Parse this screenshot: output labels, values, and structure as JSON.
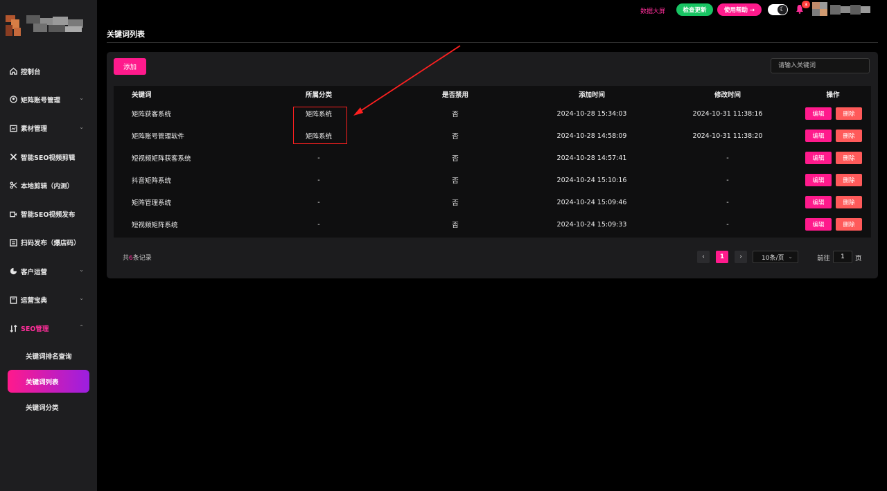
{
  "sidebar": {
    "items": [
      {
        "label": "控制台",
        "icon": "home-icon"
      },
      {
        "label": "矩阵账号管理",
        "icon": "account-icon",
        "chevron": "⌄"
      },
      {
        "label": "素材管理",
        "icon": "material-icon",
        "chevron": "⌄"
      },
      {
        "label": "智能SEO视频剪辑",
        "icon": "scissors-icon"
      },
      {
        "label": "本地剪辑（内测）",
        "icon": "cut-icon"
      },
      {
        "label": "智能SEO视频发布",
        "icon": "video-icon"
      },
      {
        "label": "扫码发布（爆店码）",
        "icon": "qrcode-icon"
      },
      {
        "label": "客户运营",
        "icon": "pie-icon",
        "chevron": "⌄"
      },
      {
        "label": "运营宝典",
        "icon": "book-icon",
        "chevron": "⌄"
      },
      {
        "label": "SEO管理",
        "icon": "seo-icon",
        "chevron": "⌃"
      }
    ],
    "sub_items": [
      {
        "label": "关键词排名查询"
      },
      {
        "label": "关键词列表"
      },
      {
        "label": "关键词分类"
      }
    ]
  },
  "topbar": {
    "dashboard_link": "数据大屏",
    "check_update": "检查更新",
    "help": "使用帮助 →",
    "notification_count": "3",
    "theme_toggle_icon": "moon-icon"
  },
  "main": {
    "title": "关键词列表",
    "add_button": "添加",
    "search_placeholder": "请输入关键词",
    "table": {
      "headers": [
        "关键词",
        "所属分类",
        "是否禁用",
        "添加时间",
        "修改时间",
        "操作"
      ],
      "rows": [
        {
          "keyword": "矩阵获客系统",
          "category": "矩阵系统",
          "disabled": "否",
          "added": "2024-10-28 15:34:03",
          "modified": "2024-10-31 11:38:16"
        },
        {
          "keyword": "矩阵账号管理软件",
          "category": "矩阵系统",
          "disabled": "否",
          "added": "2024-10-28 14:58:09",
          "modified": "2024-10-31 11:38:20"
        },
        {
          "keyword": "短视频矩阵获客系统",
          "category": "-",
          "disabled": "否",
          "added": "2024-10-28 14:57:41",
          "modified": "-"
        },
        {
          "keyword": "抖音矩阵系统",
          "category": "-",
          "disabled": "否",
          "added": "2024-10-24 15:10:16",
          "modified": "-"
        },
        {
          "keyword": "矩阵管理系统",
          "category": "-",
          "disabled": "否",
          "added": "2024-10-24 15:09:46",
          "modified": "-"
        },
        {
          "keyword": "短视频矩阵系统",
          "category": "-",
          "disabled": "否",
          "added": "2024-10-24 15:09:33",
          "modified": "-"
        }
      ],
      "edit_label": "编辑",
      "delete_label": "删除"
    },
    "pagination": {
      "total_prefix": "共",
      "total": "6",
      "total_suffix": "条记录",
      "prev": "‹",
      "current": "1",
      "next": "›",
      "page_size": "10条/页",
      "goto_prefix": "前往",
      "goto_value": "1",
      "goto_suffix": "页"
    }
  },
  "colors": {
    "accent": "#ff1a8c",
    "success": "#18c463",
    "danger": "#ff5a5a",
    "annotation": "#ff2020"
  }
}
